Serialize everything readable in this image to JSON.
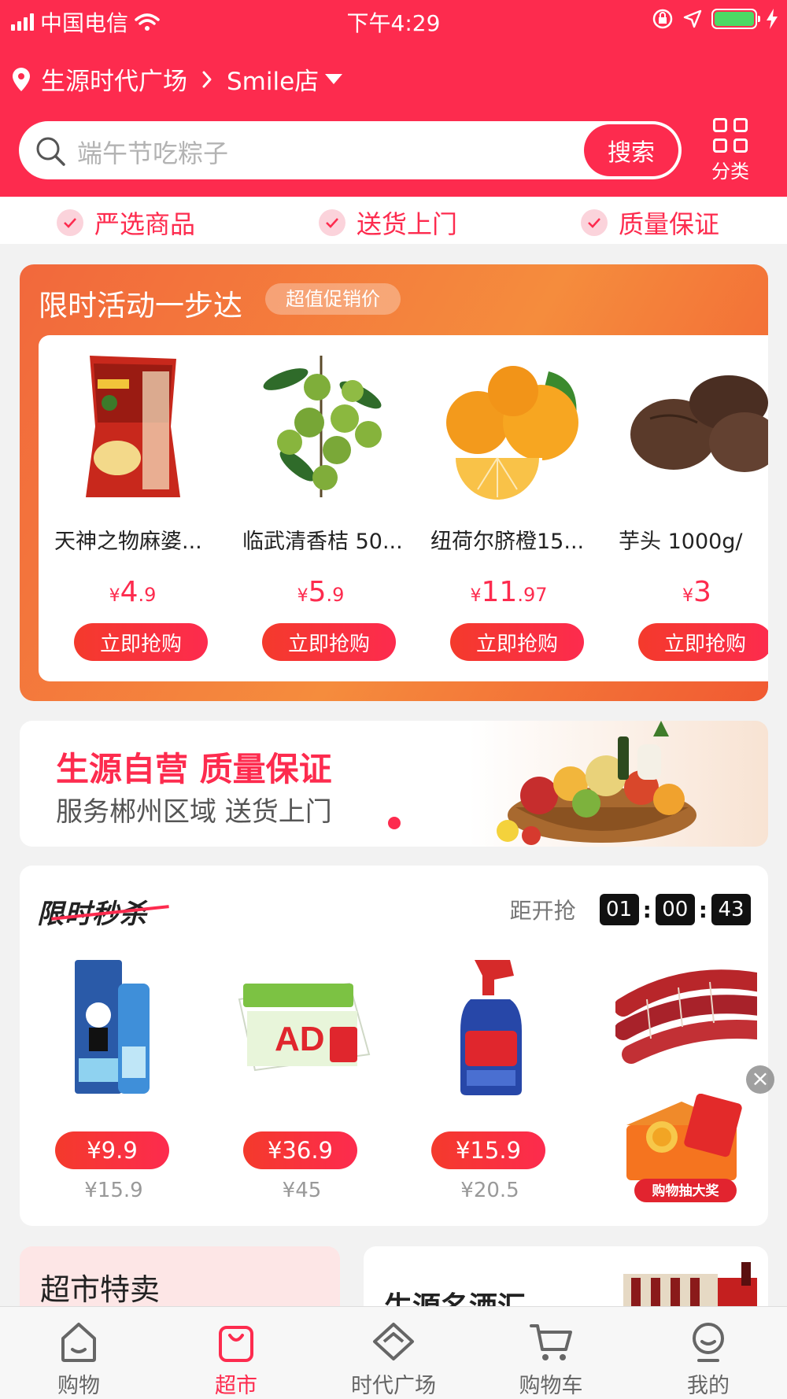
{
  "status_bar": {
    "carrier": "中国电信",
    "time": "下午4:29"
  },
  "location": {
    "place": "生源时代广场",
    "store": "Smile店"
  },
  "search": {
    "placeholder": "端午节吃粽子",
    "button": "搜索",
    "category_label": "分类"
  },
  "assurances": [
    "严选商品",
    "送货上门",
    "质量保证"
  ],
  "promo": {
    "title": "限时活动一步达",
    "tag": "超值促销价",
    "buy_label": "立即抢购",
    "items": [
      {
        "name": "天神之物麻婆...",
        "currency": "¥",
        "price_int": "4",
        "price_dec": ".9",
        "image": "chips-bag"
      },
      {
        "name": "临武清香桔 50...",
        "currency": "¥",
        "price_int": "5",
        "price_dec": ".9",
        "image": "green-kumquats"
      },
      {
        "name": "纽荷尔脐橙15...",
        "currency": "¥",
        "price_int": "11",
        "price_dec": ".97",
        "image": "navel-oranges"
      },
      {
        "name": "芋头 1000g/",
        "currency": "¥",
        "price_int": "3",
        "price_dec": "",
        "image": "taro"
      }
    ]
  },
  "banner": {
    "headline": "生源自营 质量保证",
    "subline": "服务郴州区域 送货上门",
    "image": "fruit-basket"
  },
  "seckill": {
    "title": "限时秒杀",
    "countdown_label": "距开抢",
    "countdown": [
      "01",
      "00",
      "43"
    ],
    "items": [
      {
        "price": "¥9.9",
        "old_price": "¥15.9",
        "image": "toothpaste"
      },
      {
        "price": "¥36.9",
        "old_price": "¥45",
        "image": "ad-calcium-milk"
      },
      {
        "price": "¥15.9",
        "old_price": "¥20.5",
        "image": "spray-cleaner"
      },
      {
        "price": "",
        "old_price": "",
        "image": "sausages"
      }
    ]
  },
  "floating": {
    "close": "×",
    "lottery_label": "购物抽大奖"
  },
  "cards": {
    "left_title": "超市特卖",
    "right_title": "生源名酒汇"
  },
  "tabbar": [
    {
      "label": "购物",
      "icon": "home-icon",
      "active": false
    },
    {
      "label": "超市",
      "icon": "shopping-bag-icon",
      "active": true
    },
    {
      "label": "时代广场",
      "icon": "diamond-icon",
      "active": false
    },
    {
      "label": "购物车",
      "icon": "cart-icon",
      "active": false
    },
    {
      "label": "我的",
      "icon": "profile-icon",
      "active": false
    }
  ],
  "colors": {
    "brand_red": "#fd2b4e",
    "promo_orange": "#f58c3d",
    "battery_green": "#4cd964"
  }
}
